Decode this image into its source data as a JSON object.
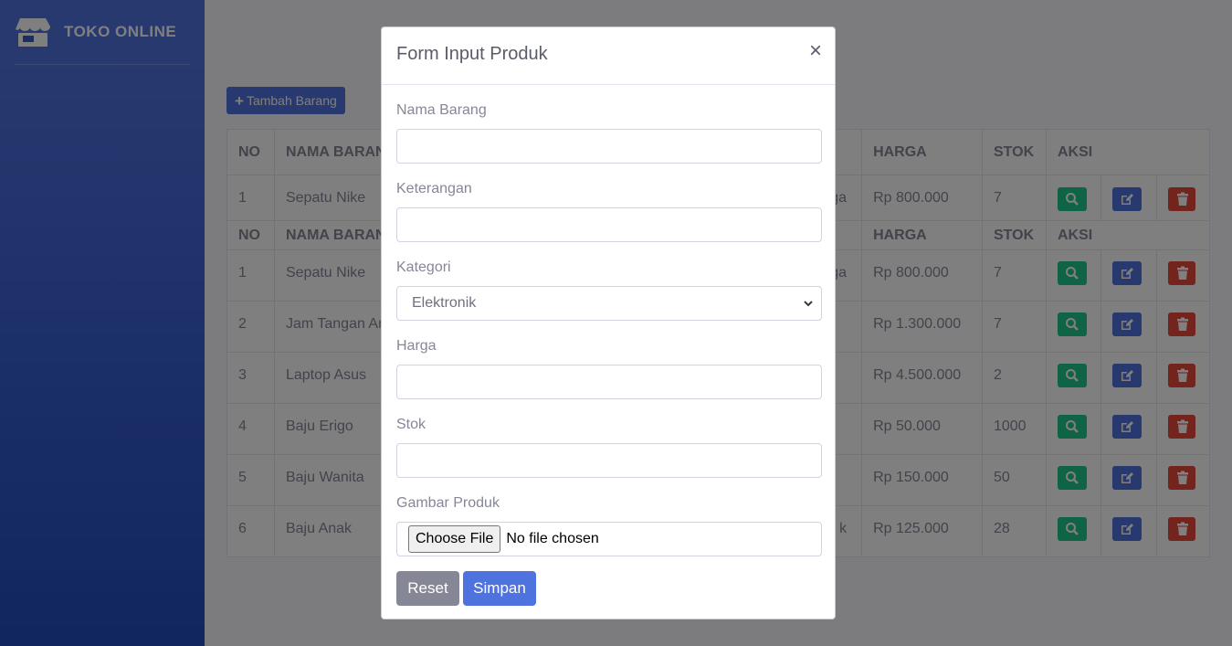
{
  "brand": {
    "name": "TOKO ONLINE",
    "icon": "store-icon"
  },
  "main": {
    "add_button_label": "Tambah Barang",
    "add_icon": "plus-icon"
  },
  "table": {
    "headers": [
      "NO",
      "NAMA BARANG",
      "HARGA",
      "STOK",
      "AKSI"
    ],
    "rows": [
      {
        "no": "1",
        "name": "Sepatu Nike",
        "kategori_tail": "ga",
        "harga": "Rp 800.000",
        "stok": "7"
      },
      {
        "no": "2",
        "name": "Jam Tangan An",
        "kategori_tail": "",
        "harga": "Rp 1.300.000",
        "stok": "7"
      },
      {
        "no": "3",
        "name": "Laptop Asus",
        "kategori_tail": "",
        "harga": "Rp 4.500.000",
        "stok": "2"
      },
      {
        "no": "4",
        "name": "Baju Erigo",
        "kategori_tail": "",
        "harga": "Rp 50.000",
        "stok": "1000"
      },
      {
        "no": "5",
        "name": "Baju Wanita",
        "kategori_tail": "",
        "harga": "Rp 150.000",
        "stok": "50"
      },
      {
        "no": "6",
        "name": "Baju Anak",
        "kategori_tail": "k",
        "harga": "Rp 125.000",
        "stok": "28"
      }
    ],
    "action_icons": [
      "search-icon",
      "edit-icon",
      "trash-icon"
    ]
  },
  "modal": {
    "title": "Form Input Produk",
    "close_label": "×",
    "fields": {
      "nama_label": "Nama Barang",
      "nama_value": "",
      "keterangan_label": "Keterangan",
      "keterangan_value": "",
      "kategori_label": "Kategori",
      "kategori_value": "Elektronik",
      "harga_label": "Harga",
      "harga_value": "",
      "stok_label": "Stok",
      "stok_value": "",
      "gambar_label": "Gambar Produk",
      "file_button": "Choose File",
      "file_status": "No file chosen"
    },
    "reset_label": "Reset",
    "save_label": "Simpan"
  },
  "colors": {
    "primary": "#4e73df",
    "success": "#1cc88a",
    "danger": "#e74a3b",
    "secondary": "#858796"
  }
}
